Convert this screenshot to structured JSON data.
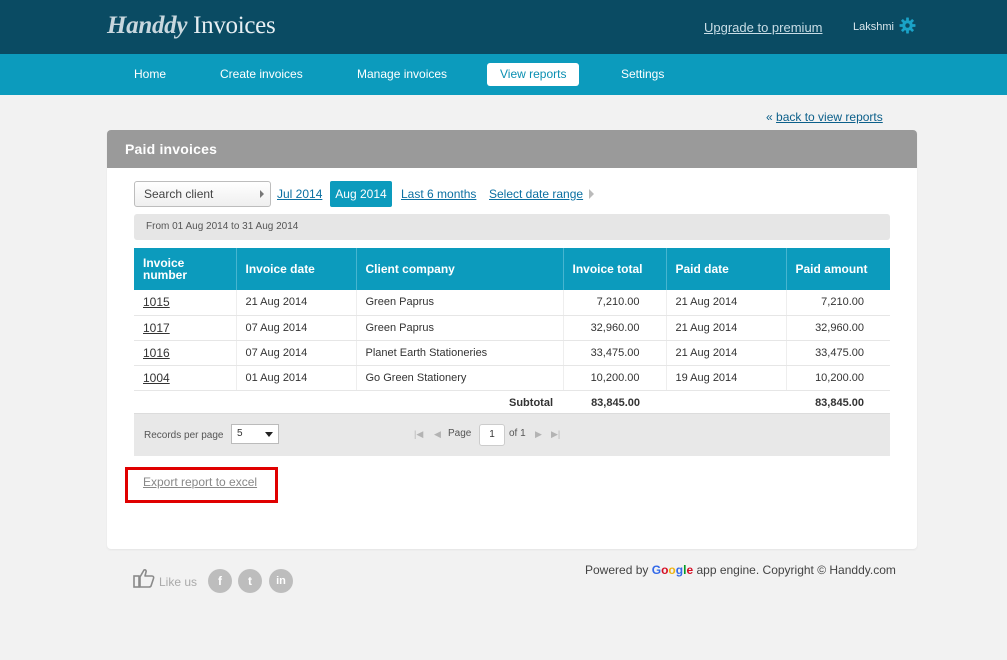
{
  "header": {
    "logo_brand": "Handdy",
    "logo_product": "Invoices",
    "upgrade_link": "Upgrade to premium",
    "username": "Lakshmi",
    "gear_icon": "gear-icon"
  },
  "nav": {
    "items": [
      {
        "label": "Home",
        "active": false
      },
      {
        "label": "Create invoices",
        "active": false
      },
      {
        "label": "Manage invoices",
        "active": false
      },
      {
        "label": "View reports",
        "active": true
      },
      {
        "label": "Settings",
        "active": false
      }
    ]
  },
  "back_link": {
    "arrow": "«",
    "label": "back to view reports"
  },
  "panel": {
    "title": "Paid invoices",
    "search_placeholder": "Search client",
    "filters": {
      "prev_month": "Jul 2014",
      "current_month": "Aug 2014",
      "last_6_months": "Last 6 months",
      "select_range": "Select date range"
    },
    "date_range_text": "From 01 Aug 2014 to 31 Aug 2014"
  },
  "table": {
    "columns": [
      "Invoice number",
      "Invoice date",
      "Client company",
      "Invoice total",
      "Paid date",
      "Paid amount"
    ],
    "column_lines": [
      [
        "Invoice",
        "number"
      ]
    ],
    "rows": [
      {
        "invoice_number": "1015",
        "invoice_date": "21 Aug 2014",
        "client": "Green Paprus",
        "invoice_total": "7,210.00",
        "paid_date": "21 Aug 2014",
        "paid_amount": "7,210.00"
      },
      {
        "invoice_number": "1017",
        "invoice_date": "07 Aug 2014",
        "client": "Green Paprus",
        "invoice_total": "32,960.00",
        "paid_date": "21 Aug 2014",
        "paid_amount": "32,960.00"
      },
      {
        "invoice_number": "1016",
        "invoice_date": "07 Aug 2014",
        "client": "Planet Earth Stationeries",
        "invoice_total": "33,475.00",
        "paid_date": "21 Aug 2014",
        "paid_amount": "33,475.00"
      },
      {
        "invoice_number": "1004",
        "invoice_date": "01 Aug 2014",
        "client": "Go Green Stationery",
        "invoice_total": "10,200.00",
        "paid_date": "19 Aug 2014",
        "paid_amount": "10,200.00"
      }
    ],
    "subtotal_label": "Subtotal",
    "subtotal_invoice_total": "83,845.00",
    "subtotal_paid_amount": "83,845.00"
  },
  "pager": {
    "records_per_page_label": "Records per page",
    "records_per_page_value": "5",
    "page_label": "Page",
    "page_value": "1",
    "of_label": "of 1"
  },
  "export_link": "Export report to excel",
  "footer": {
    "like_label": "Like us",
    "social": [
      {
        "name": "facebook-icon",
        "glyph": "f"
      },
      {
        "name": "twitter-icon",
        "glyph": "t"
      },
      {
        "name": "linkedin-icon",
        "glyph": "in"
      }
    ],
    "powered_prefix": "Powered by",
    "google_letters": [
      "G",
      "o",
      "o",
      "g",
      "l",
      "e"
    ],
    "powered_suffix": "app engine. Copyright © Handdy.com"
  }
}
